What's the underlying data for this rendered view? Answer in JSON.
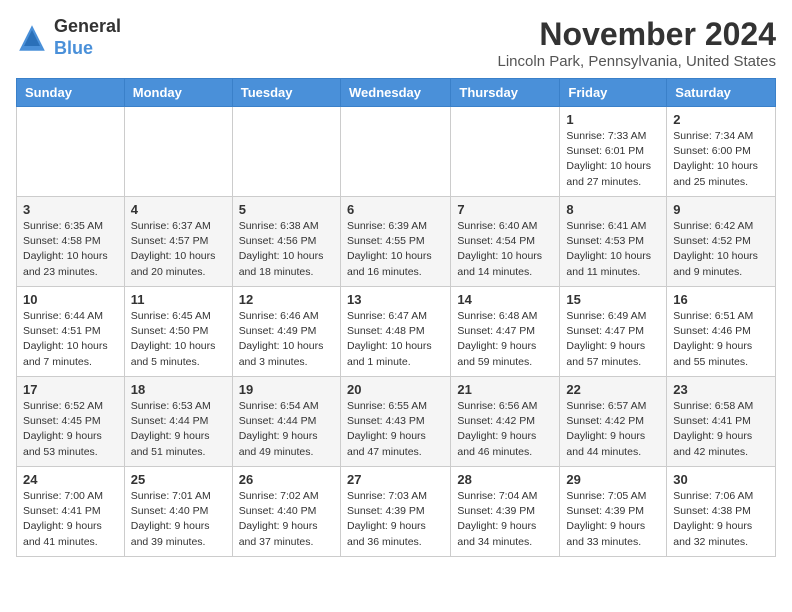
{
  "logo": {
    "general": "General",
    "blue": "Blue"
  },
  "title": "November 2024",
  "location": "Lincoln Park, Pennsylvania, United States",
  "days_of_week": [
    "Sunday",
    "Monday",
    "Tuesday",
    "Wednesday",
    "Thursday",
    "Friday",
    "Saturday"
  ],
  "weeks": [
    [
      {
        "day": "",
        "info": ""
      },
      {
        "day": "",
        "info": ""
      },
      {
        "day": "",
        "info": ""
      },
      {
        "day": "",
        "info": ""
      },
      {
        "day": "",
        "info": ""
      },
      {
        "day": "1",
        "info": "Sunrise: 7:33 AM\nSunset: 6:01 PM\nDaylight: 10 hours and 27 minutes."
      },
      {
        "day": "2",
        "info": "Sunrise: 7:34 AM\nSunset: 6:00 PM\nDaylight: 10 hours and 25 minutes."
      }
    ],
    [
      {
        "day": "3",
        "info": "Sunrise: 6:35 AM\nSunset: 4:58 PM\nDaylight: 10 hours and 23 minutes."
      },
      {
        "day": "4",
        "info": "Sunrise: 6:37 AM\nSunset: 4:57 PM\nDaylight: 10 hours and 20 minutes."
      },
      {
        "day": "5",
        "info": "Sunrise: 6:38 AM\nSunset: 4:56 PM\nDaylight: 10 hours and 18 minutes."
      },
      {
        "day": "6",
        "info": "Sunrise: 6:39 AM\nSunset: 4:55 PM\nDaylight: 10 hours and 16 minutes."
      },
      {
        "day": "7",
        "info": "Sunrise: 6:40 AM\nSunset: 4:54 PM\nDaylight: 10 hours and 14 minutes."
      },
      {
        "day": "8",
        "info": "Sunrise: 6:41 AM\nSunset: 4:53 PM\nDaylight: 10 hours and 11 minutes."
      },
      {
        "day": "9",
        "info": "Sunrise: 6:42 AM\nSunset: 4:52 PM\nDaylight: 10 hours and 9 minutes."
      }
    ],
    [
      {
        "day": "10",
        "info": "Sunrise: 6:44 AM\nSunset: 4:51 PM\nDaylight: 10 hours and 7 minutes."
      },
      {
        "day": "11",
        "info": "Sunrise: 6:45 AM\nSunset: 4:50 PM\nDaylight: 10 hours and 5 minutes."
      },
      {
        "day": "12",
        "info": "Sunrise: 6:46 AM\nSunset: 4:49 PM\nDaylight: 10 hours and 3 minutes."
      },
      {
        "day": "13",
        "info": "Sunrise: 6:47 AM\nSunset: 4:48 PM\nDaylight: 10 hours and 1 minute."
      },
      {
        "day": "14",
        "info": "Sunrise: 6:48 AM\nSunset: 4:47 PM\nDaylight: 9 hours and 59 minutes."
      },
      {
        "day": "15",
        "info": "Sunrise: 6:49 AM\nSunset: 4:47 PM\nDaylight: 9 hours and 57 minutes."
      },
      {
        "day": "16",
        "info": "Sunrise: 6:51 AM\nSunset: 4:46 PM\nDaylight: 9 hours and 55 minutes."
      }
    ],
    [
      {
        "day": "17",
        "info": "Sunrise: 6:52 AM\nSunset: 4:45 PM\nDaylight: 9 hours and 53 minutes."
      },
      {
        "day": "18",
        "info": "Sunrise: 6:53 AM\nSunset: 4:44 PM\nDaylight: 9 hours and 51 minutes."
      },
      {
        "day": "19",
        "info": "Sunrise: 6:54 AM\nSunset: 4:44 PM\nDaylight: 9 hours and 49 minutes."
      },
      {
        "day": "20",
        "info": "Sunrise: 6:55 AM\nSunset: 4:43 PM\nDaylight: 9 hours and 47 minutes."
      },
      {
        "day": "21",
        "info": "Sunrise: 6:56 AM\nSunset: 4:42 PM\nDaylight: 9 hours and 46 minutes."
      },
      {
        "day": "22",
        "info": "Sunrise: 6:57 AM\nSunset: 4:42 PM\nDaylight: 9 hours and 44 minutes."
      },
      {
        "day": "23",
        "info": "Sunrise: 6:58 AM\nSunset: 4:41 PM\nDaylight: 9 hours and 42 minutes."
      }
    ],
    [
      {
        "day": "24",
        "info": "Sunrise: 7:00 AM\nSunset: 4:41 PM\nDaylight: 9 hours and 41 minutes."
      },
      {
        "day": "25",
        "info": "Sunrise: 7:01 AM\nSunset: 4:40 PM\nDaylight: 9 hours and 39 minutes."
      },
      {
        "day": "26",
        "info": "Sunrise: 7:02 AM\nSunset: 4:40 PM\nDaylight: 9 hours and 37 minutes."
      },
      {
        "day": "27",
        "info": "Sunrise: 7:03 AM\nSunset: 4:39 PM\nDaylight: 9 hours and 36 minutes."
      },
      {
        "day": "28",
        "info": "Sunrise: 7:04 AM\nSunset: 4:39 PM\nDaylight: 9 hours and 34 minutes."
      },
      {
        "day": "29",
        "info": "Sunrise: 7:05 AM\nSunset: 4:39 PM\nDaylight: 9 hours and 33 minutes."
      },
      {
        "day": "30",
        "info": "Sunrise: 7:06 AM\nSunset: 4:38 PM\nDaylight: 9 hours and 32 minutes."
      }
    ]
  ]
}
